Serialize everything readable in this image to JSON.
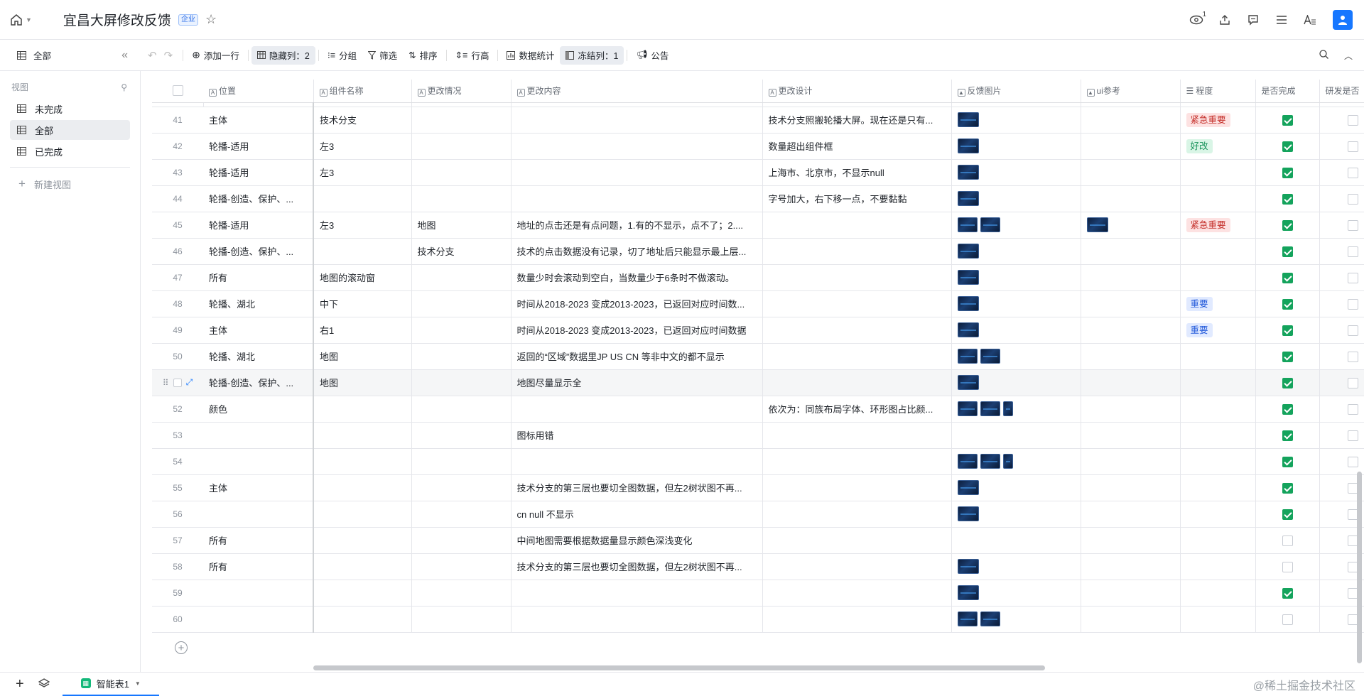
{
  "header": {
    "title": "宜昌大屏修改反馈",
    "badge": "企业",
    "notification_count": "1"
  },
  "toolbar": {
    "view_name": "全部",
    "add_row": "添加一行",
    "hidden_cols": "隐藏列：2",
    "group": "分组",
    "filter": "筛选",
    "sort": "排序",
    "row_height": "行高",
    "stats": "数据统计",
    "frozen_cols": "冻结列：1",
    "announce": "公告"
  },
  "sidebar": {
    "heading": "视图",
    "items": [
      {
        "label": "未完成",
        "active": false
      },
      {
        "label": "全部",
        "active": true
      },
      {
        "label": "已完成",
        "active": false
      }
    ],
    "new_view": "新建视图"
  },
  "columns": [
    "位置",
    "组件名称",
    "更改情况",
    "更改内容",
    "更改设计",
    "反馈图片",
    "ui参考",
    "程度",
    "是否完成",
    "研发是否"
  ],
  "rows": [
    {
      "n": "41",
      "pos": "主体",
      "comp": "技术分支",
      "status": "",
      "content": "",
      "design": "技术分支照搬轮播大屏。现在还是只有...",
      "imgs": 1,
      "ui": 0,
      "level": "紧急重要",
      "done": true
    },
    {
      "n": "42",
      "pos": "轮播-适用",
      "comp": "左3",
      "status": "",
      "content": "",
      "design": "数量超出组件框",
      "imgs": 1,
      "ui": 0,
      "level": "好改",
      "done": true
    },
    {
      "n": "43",
      "pos": "轮播-适用",
      "comp": "左3",
      "status": "",
      "content": "",
      "design": "上海市、北京市，不显示null",
      "imgs": 1,
      "ui": 0,
      "level": "",
      "done": true
    },
    {
      "n": "44",
      "pos": "轮播-创造、保护、...",
      "comp": "",
      "status": "",
      "content": "",
      "design": "字号加大，右下移一点，不要黏黏",
      "imgs": 1,
      "ui": 0,
      "level": "",
      "done": true
    },
    {
      "n": "45",
      "pos": "轮播-适用",
      "comp": "左3",
      "status": "地图",
      "content": "地址的点击还是有点问题，1.有的不显示，点不了；2....",
      "design": "",
      "imgs": 2,
      "ui": 1,
      "level": "紧急重要",
      "done": true
    },
    {
      "n": "46",
      "pos": "轮播-创造、保护、...",
      "comp": "",
      "status": "技术分支",
      "content": "技术的点击数据没有记录，切了地址后只能显示最上层...",
      "design": "",
      "imgs": 1,
      "ui": 0,
      "level": "",
      "done": true
    },
    {
      "n": "47",
      "pos": "所有",
      "comp": "地图的滚动窗",
      "status": "",
      "content": "数量少时会滚动到空白，当数量少于6条时不做滚动。",
      "design": "",
      "imgs": 1,
      "ui": 0,
      "level": "",
      "done": true
    },
    {
      "n": "48",
      "pos": "轮播、湖北",
      "comp": "中下",
      "status": "",
      "content": "时间从2018-2023 变成2013-2023，已返回对应时间数...",
      "design": "",
      "imgs": 1,
      "ui": 0,
      "level": "重要",
      "done": true
    },
    {
      "n": "49",
      "pos": "主体",
      "comp": "右1",
      "status": "",
      "content": "时间从2018-2023 变成2013-2023，已返回对应时间数据",
      "design": "",
      "imgs": 1,
      "ui": 0,
      "level": "重要",
      "done": true
    },
    {
      "n": "50",
      "pos": "轮播、湖北",
      "comp": "地图",
      "status": "",
      "content": "返回的“区域”数据里JP US CN 等非中文的都不显示",
      "design": "",
      "imgs": 2,
      "ui": 0,
      "level": "",
      "done": true
    },
    {
      "n": "",
      "pos": "轮播-创造、保护、...",
      "comp": "地图",
      "status": "",
      "content": "地图尽量显示全",
      "design": "",
      "imgs": 1,
      "ui": 0,
      "level": "",
      "done": true
    },
    {
      "n": "52",
      "pos": "颜色",
      "comp": "",
      "status": "",
      "content": "",
      "design": "依次为：同族布局字体、环形图占比颜...",
      "imgs": 3,
      "ui": 0,
      "level": "",
      "done": true
    },
    {
      "n": "53",
      "pos": "",
      "comp": "",
      "status": "",
      "content": "图标用错",
      "design": "",
      "imgs": 0,
      "ui": 0,
      "level": "",
      "done": true
    },
    {
      "n": "54",
      "pos": "",
      "comp": "",
      "status": "",
      "content": "",
      "design": "",
      "imgs": 3,
      "ui": 0,
      "level": "",
      "done": true
    },
    {
      "n": "55",
      "pos": "主体",
      "comp": "",
      "status": "",
      "content": "技术分支的第三层也要切全图数据，但左2树状图不再...",
      "design": "",
      "imgs": 1,
      "ui": 0,
      "level": "",
      "done": true
    },
    {
      "n": "56",
      "pos": "",
      "comp": "",
      "status": "",
      "content": "cn  null 不显示",
      "design": "",
      "imgs": 1,
      "ui": 0,
      "level": "",
      "done": true
    },
    {
      "n": "57",
      "pos": "所有",
      "comp": "",
      "status": "",
      "content": "中间地图需要根据数据量显示颜色深浅变化",
      "design": "",
      "imgs": 0,
      "ui": 0,
      "level": "",
      "done": false
    },
    {
      "n": "58",
      "pos": "所有",
      "comp": "",
      "status": "",
      "content": "技术分支的第三层也要切全图数据，但左2树状图不再...",
      "design": "",
      "imgs": 1,
      "ui": 0,
      "level": "",
      "done": false
    },
    {
      "n": "59",
      "pos": "",
      "comp": "",
      "status": "",
      "content": "",
      "design": "",
      "imgs": 1,
      "ui": 0,
      "level": "",
      "done": true
    },
    {
      "n": "60",
      "pos": "",
      "comp": "",
      "status": "",
      "content": "",
      "design": "",
      "imgs": 2,
      "ui": 0,
      "level": "",
      "done": false
    }
  ],
  "tag_colors": {
    "紧急重要": {
      "bg": "#fde2e2",
      "fg": "#c5322c"
    },
    "好改": {
      "bg": "#d9f5e6",
      "fg": "#17925a"
    },
    "重要": {
      "bg": "#e1eaff",
      "fg": "#245bdb"
    }
  },
  "bottom": {
    "sheet_name": "智能表1",
    "watermark": "@稀土掘金技术社区"
  }
}
